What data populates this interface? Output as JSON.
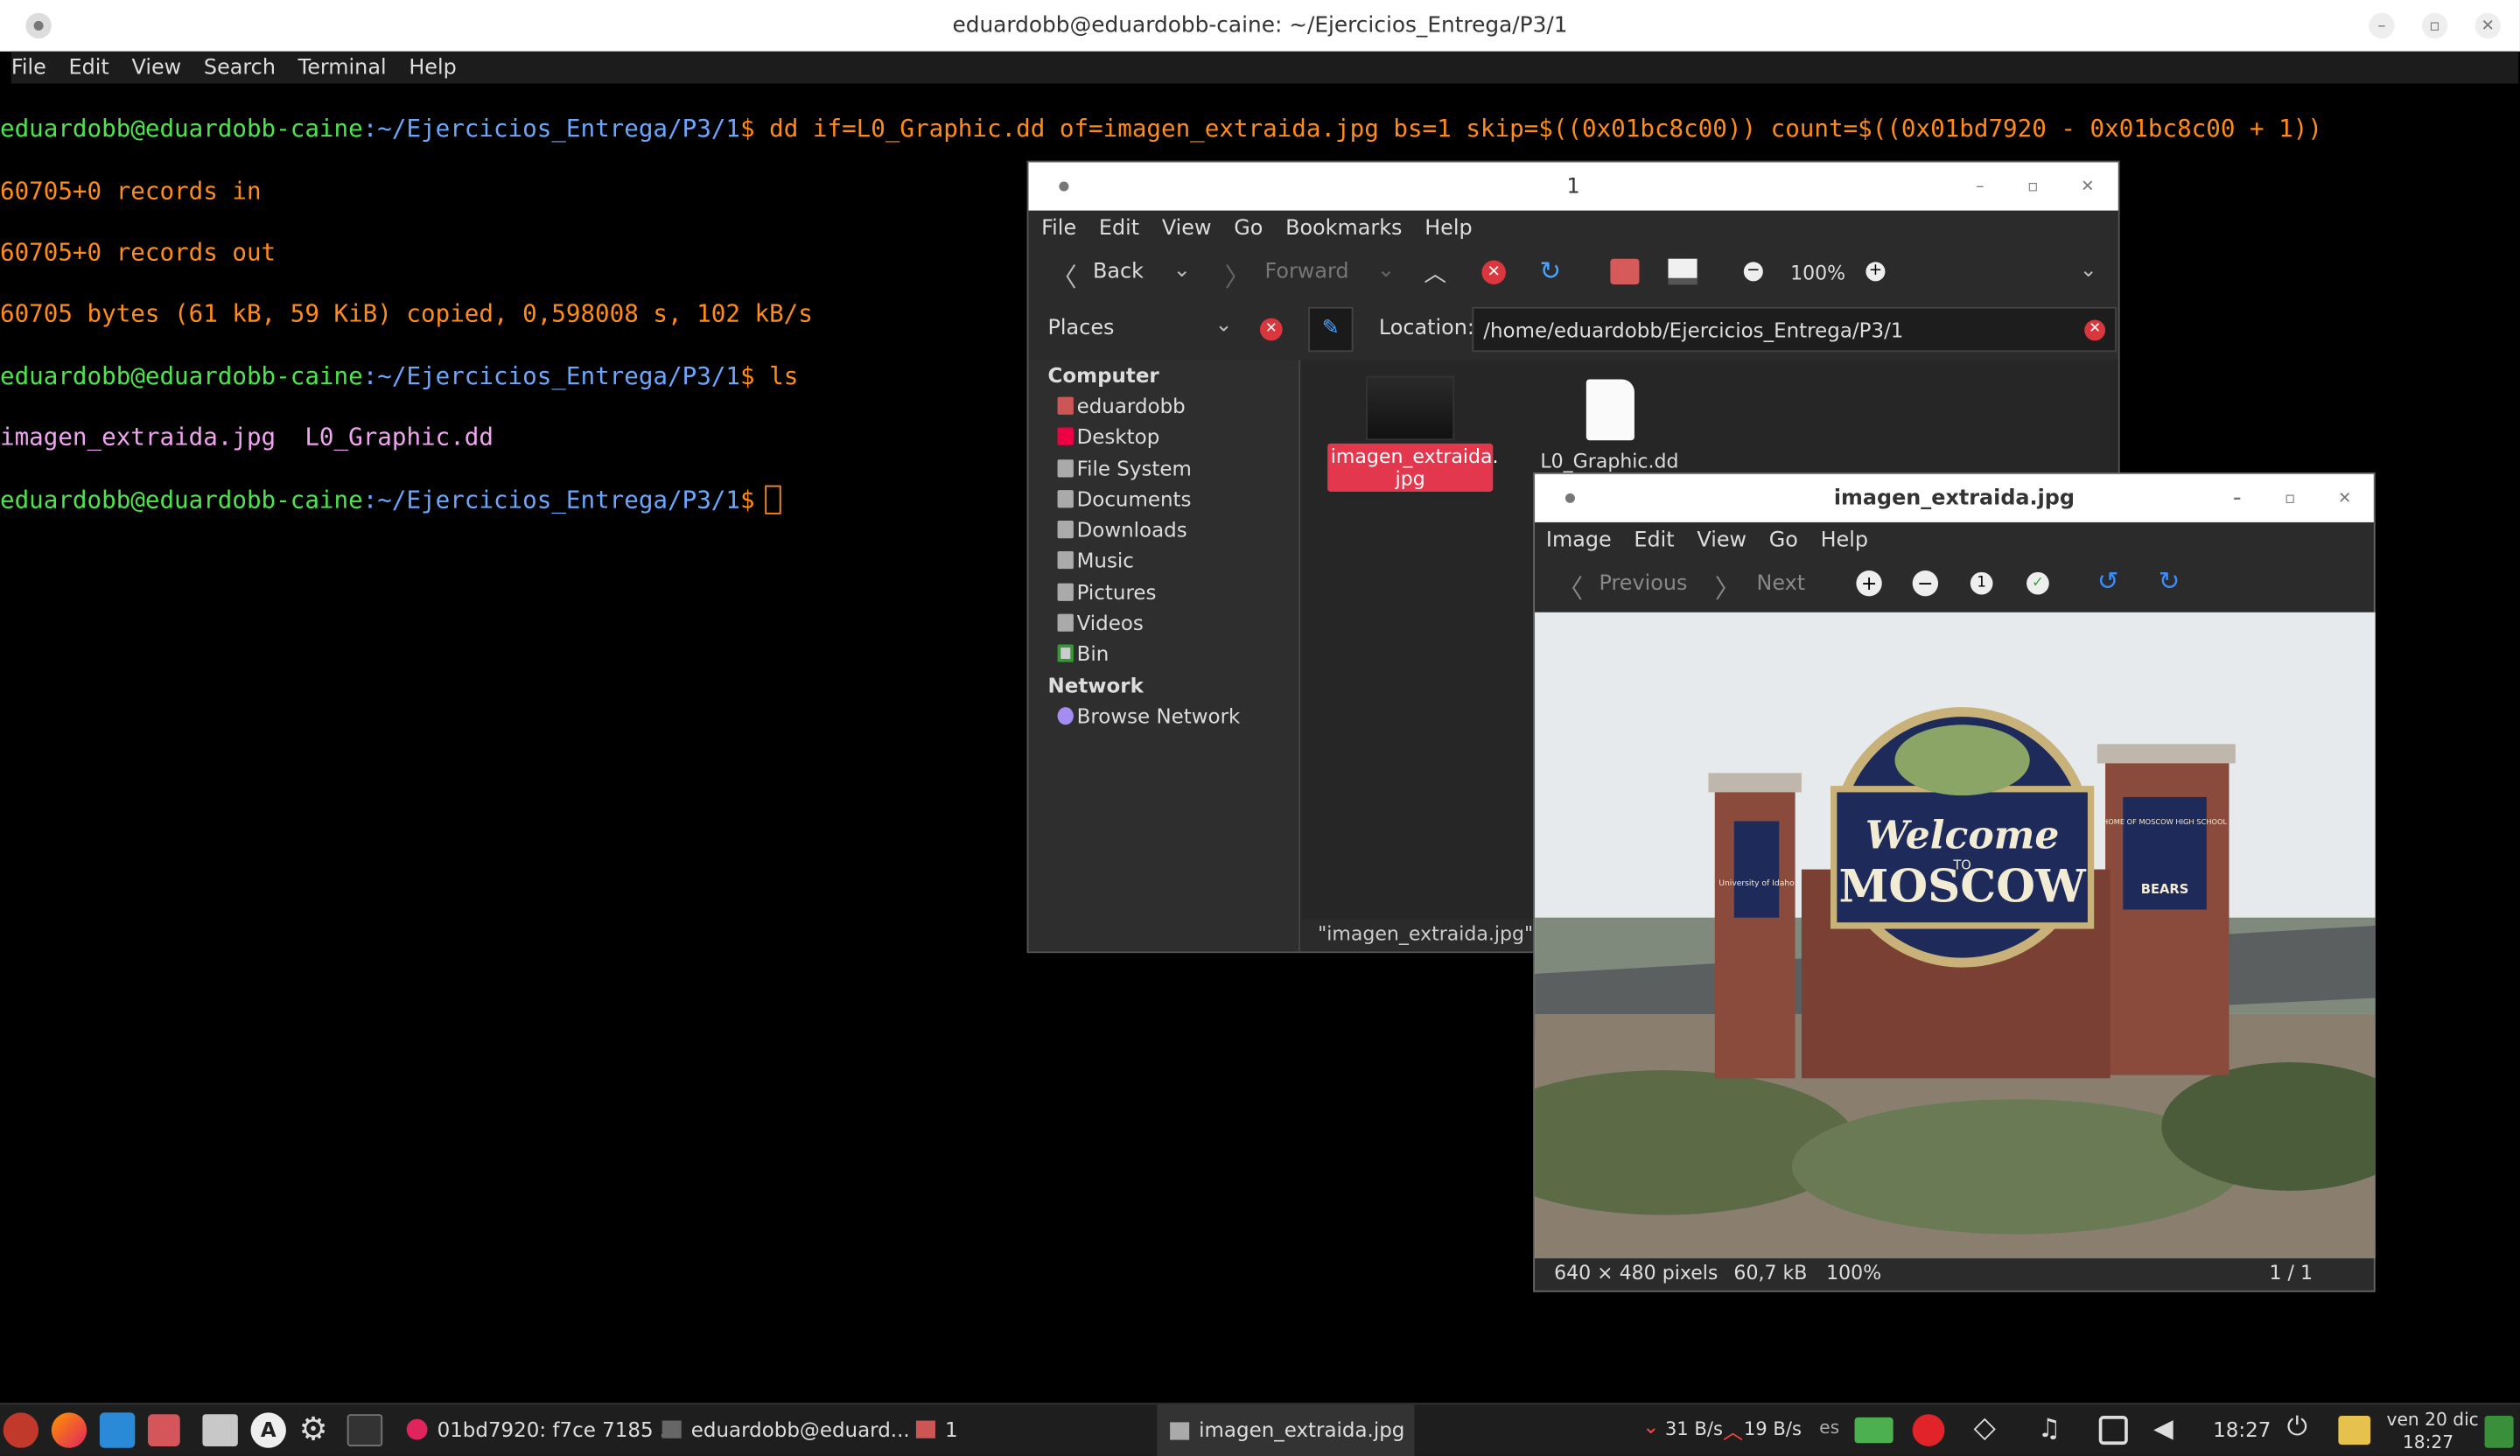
{
  "terminal": {
    "title": "eduardobb@eduardobb-caine: ~/Ejercicios_Entrega/P3/1",
    "menu": [
      "File",
      "Edit",
      "View",
      "Search",
      "Terminal",
      "Help"
    ],
    "prompt_user": "eduardobb@eduardobb-caine",
    "prompt_path": ":~/Ejercicios_Entrega/P3/1",
    "prompt_sym": "$",
    "cmd1": " dd if=L0_Graphic.dd of=imagen_extraida.jpg bs=1 skip=$((0x01bc8c00)) count=$((0x01bd7920 - 0x01bc8c00 + 1))",
    "out1": "60705+0 records in",
    "out2": "60705+0 records out",
    "out3": "60705 bytes (61 kB, 59 KiB) copied, 0,598008 s, 102 kB/s",
    "cmd2": " ls",
    "ls_file1": "imagen_extraida.jpg",
    "ls_file2": "L0_Graphic.dd"
  },
  "file_manager": {
    "title": "1",
    "menu": [
      "File",
      "Edit",
      "View",
      "Go",
      "Bookmarks",
      "Help"
    ],
    "back": "Back",
    "forward": "Forward",
    "zoom": "100%",
    "places_label": "Places",
    "location_label": "Location:",
    "location_value": "/home/eduardobb/Ejercicios_Entrega/P3/1",
    "sidebar": {
      "computer": "Computer",
      "items": [
        "eduardobb",
        "Desktop",
        "File System",
        "Documents",
        "Downloads",
        "Music",
        "Pictures",
        "Videos",
        "Bin"
      ],
      "network": "Network",
      "network_items": [
        "Browse Network"
      ]
    },
    "files": [
      "imagen_extraida.\njpg",
      "L0_Graphic.dd"
    ],
    "status": "\"imagen_extraida.jpg\" se"
  },
  "image_viewer": {
    "title": "imagen_extraida.jpg",
    "menu": [
      "Image",
      "Edit",
      "View",
      "Go",
      "Help"
    ],
    "previous": "Previous",
    "next": "Next",
    "status_size": "640 × 480 pixels",
    "status_bytes": "60,7 kB",
    "status_zoom": "100%",
    "status_count": "1 / 1",
    "sign_welcome": "Welcome",
    "sign_to": "TO",
    "sign_city": "MOSCOW",
    "sign_left": "University of Idaho",
    "sign_right_top": "HOME OF MOSCOW HIGH SCHOOL",
    "sign_right_bottom": "BEARS"
  },
  "taskbar": {
    "task1": "01bd7920: f7ce 7185 ...",
    "task2": "eduardobb@eduard...",
    "task3": "1",
    "task4": "imagen_extraida.jpg",
    "net_down": "31 B/s",
    "net_up": "19 B/s",
    "lang": "es",
    "time": "18:27",
    "date": "ven 20 dic",
    "time2": "18:27"
  }
}
